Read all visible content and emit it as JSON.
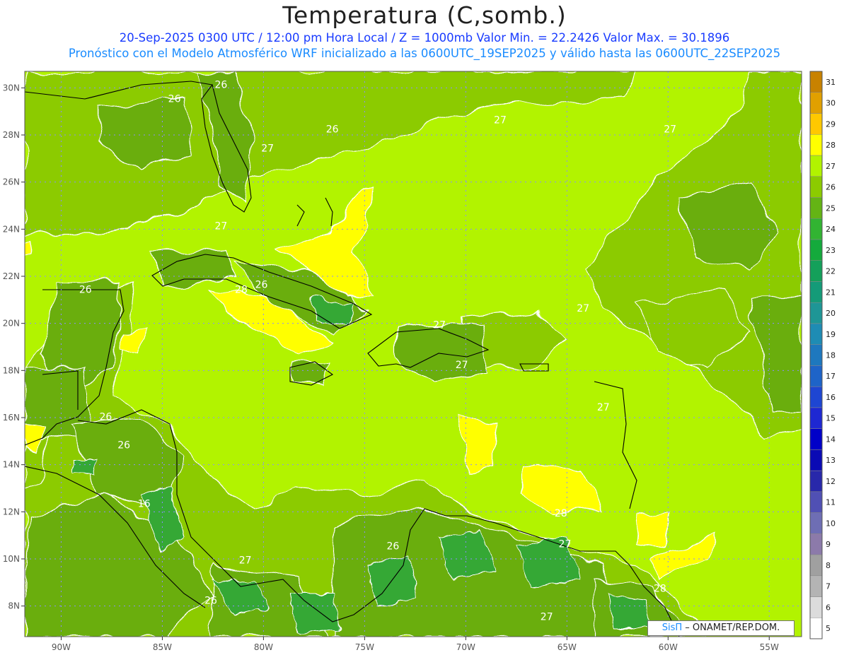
{
  "header": {
    "title": "Temperatura (C,somb.)",
    "line1": "20-Sep-2025 0300 UTC / 12:00 pm Hora Local / Z = 1000mb  Valor Min. = 22.2426  Valor Max. = 30.1896",
    "line2": "Pronóstico con el Modelo Atmosférico WRF inicializado a las 0600UTC_19SEP2025 y válido hasta las  0600UTC_22SEP2025"
  },
  "map": {
    "lon_range": [
      -91.8,
      -53.4
    ],
    "lat_range": [
      6.7,
      30.7
    ],
    "lon_ticks": [
      "90W",
      "85W",
      "80W",
      "75W",
      "70W",
      "65W",
      "60W",
      "55W"
    ],
    "lon_tick_values": [
      -90,
      -85,
      -80,
      -75,
      -70,
      -65,
      -60,
      -55
    ],
    "lat_ticks": [
      "8N",
      "10N",
      "12N",
      "14N",
      "16N",
      "18N",
      "20N",
      "22N",
      "24N",
      "26N",
      "28N",
      "30N"
    ],
    "lat_tick_values": [
      8,
      10,
      12,
      14,
      16,
      18,
      20,
      22,
      24,
      26,
      28,
      30
    ],
    "contour_labels": [
      {
        "text": "26",
        "lon": -82.1,
        "lat": 30.0
      },
      {
        "text": "26",
        "lon": -84.4,
        "lat": 29.4
      },
      {
        "text": "26",
        "lon": -76.6,
        "lat": 28.1
      },
      {
        "text": "27",
        "lon": -79.8,
        "lat": 27.3
      },
      {
        "text": "27",
        "lon": -68.3,
        "lat": 28.5
      },
      {
        "text": "27",
        "lon": -59.9,
        "lat": 28.1
      },
      {
        "text": "27",
        "lon": -82.1,
        "lat": 24.0
      },
      {
        "text": "26",
        "lon": -88.8,
        "lat": 21.3
      },
      {
        "text": "28",
        "lon": -81.1,
        "lat": 21.3
      },
      {
        "text": "26",
        "lon": -80.1,
        "lat": 21.5
      },
      {
        "text": "27",
        "lon": -64.2,
        "lat": 20.5
      },
      {
        "text": "27",
        "lon": -71.3,
        "lat": 19.8
      },
      {
        "text": "27",
        "lon": -70.2,
        "lat": 18.1
      },
      {
        "text": "27",
        "lon": -63.2,
        "lat": 16.3
      },
      {
        "text": "26",
        "lon": -87.8,
        "lat": 15.9
      },
      {
        "text": "26",
        "lon": -86.9,
        "lat": 14.7
      },
      {
        "text": "16",
        "lon": -85.9,
        "lat": 12.2
      },
      {
        "text": "28",
        "lon": -65.3,
        "lat": 11.8
      },
      {
        "text": "26",
        "lon": -73.6,
        "lat": 10.4
      },
      {
        "text": "27",
        "lon": -65.1,
        "lat": 10.5
      },
      {
        "text": "27",
        "lon": -80.9,
        "lat": 9.8
      },
      {
        "text": "26",
        "lon": -82.6,
        "lat": 8.1
      },
      {
        "text": "28",
        "lon": -60.4,
        "lat": 8.6
      },
      {
        "text": "27",
        "lon": -66.0,
        "lat": 7.4
      }
    ],
    "colors": {
      "t24": "#36a836",
      "t25": "#6aae10",
      "t26": "#8ccb00",
      "t27": "#b2f300",
      "t28": "#ffff00",
      "contour": "#ffffff",
      "coast": "#000000",
      "grid": "#8c8cff"
    }
  },
  "colorbar": {
    "levels": [
      "5",
      "6",
      "7",
      "8",
      "9",
      "10",
      "11",
      "12",
      "13",
      "14",
      "15",
      "16",
      "17",
      "18",
      "19",
      "20",
      "21",
      "22",
      "23",
      "24",
      "25",
      "26",
      "27",
      "28",
      "29",
      "30",
      "31"
    ],
    "colors": [
      "#ffffff",
      "#dcdcdc",
      "#b4b4b4",
      "#a0a0a0",
      "#8c7aaa",
      "#6e6eb4",
      "#5050b4",
      "#2828aa",
      "#0a0ab4",
      "#0000c8",
      "#1e28d2",
      "#1e46d2",
      "#1e64c8",
      "#1e78be",
      "#1e8cb4",
      "#1e9696",
      "#149b78",
      "#14a05a",
      "#14aa3c",
      "#32b432",
      "#64b414",
      "#8ccb00",
      "#b2f300",
      "#ffff00",
      "#ffc800",
      "#e1a000",
      "#c88200"
    ]
  },
  "credit": {
    "brand": "SisΠ",
    "text": " – ONAMET/REP.DOM."
  }
}
